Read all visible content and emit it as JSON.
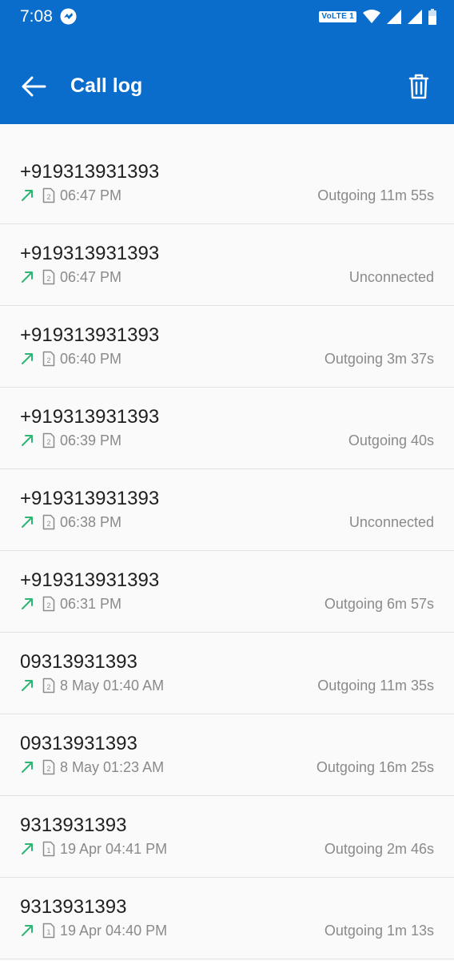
{
  "status_bar": {
    "time": "7:08",
    "network_badge": "VoLTE 1"
  },
  "header": {
    "title": "Call log",
    "back_icon": "back-arrow-icon",
    "delete_icon": "trash-icon"
  },
  "colors": {
    "primary": "#0a6ccb",
    "outgoing_arrow": "#2bb673",
    "text_primary": "#1f1f1f",
    "text_secondary": "#8a8a8a"
  },
  "calls": [
    {
      "number": "+919313931393",
      "sim": "2",
      "time": "06:47 PM",
      "status": "Outgoing 11m 55s"
    },
    {
      "number": "+919313931393",
      "sim": "2",
      "time": "06:47 PM",
      "status": "Unconnected"
    },
    {
      "number": "+919313931393",
      "sim": "2",
      "time": "06:40 PM",
      "status": "Outgoing 3m 37s"
    },
    {
      "number": "+919313931393",
      "sim": "2",
      "time": "06:39 PM",
      "status": "Outgoing 40s"
    },
    {
      "number": "+919313931393",
      "sim": "2",
      "time": "06:38 PM",
      "status": "Unconnected"
    },
    {
      "number": "+919313931393",
      "sim": "2",
      "time": "06:31 PM",
      "status": "Outgoing 6m 57s"
    },
    {
      "number": "09313931393",
      "sim": "2",
      "time": "8 May 01:40 AM",
      "status": "Outgoing 11m 35s"
    },
    {
      "number": "09313931393",
      "sim": "2",
      "time": "8 May 01:23 AM",
      "status": "Outgoing 16m 25s"
    },
    {
      "number": "9313931393",
      "sim": "1",
      "time": "19 Apr 04:41 PM",
      "status": "Outgoing 2m 46s"
    },
    {
      "number": "9313931393",
      "sim": "1",
      "time": "19 Apr 04:40 PM",
      "status": "Outgoing 1m 13s"
    }
  ]
}
